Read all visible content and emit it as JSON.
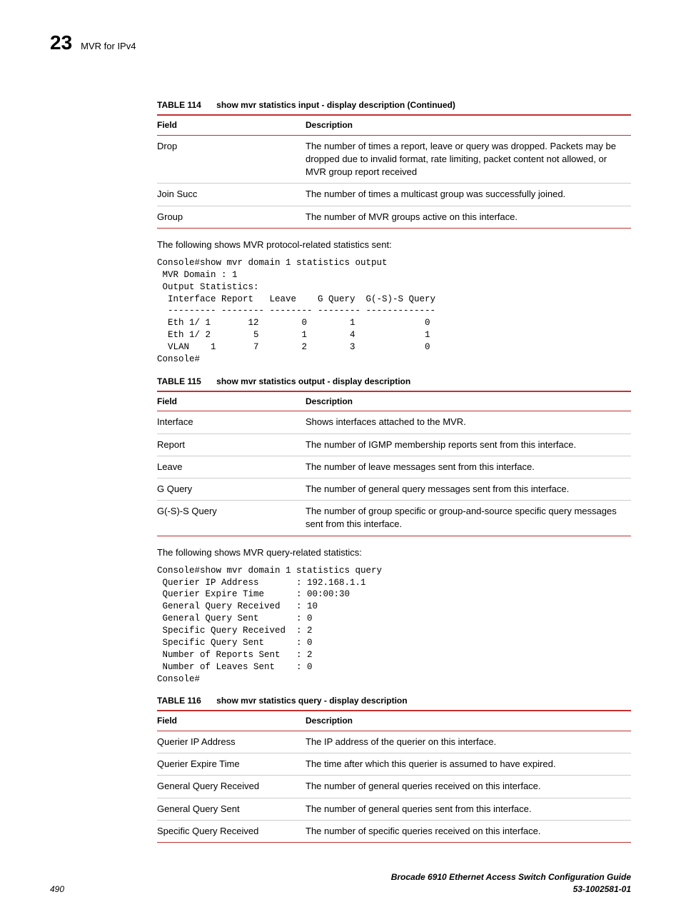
{
  "header": {
    "chapter_num": "23",
    "chapter_title": "MVR for IPv4"
  },
  "table114": {
    "label": "TABLE 114",
    "title": "show mvr statistics input - display description (Continued)",
    "head_field": "Field",
    "head_desc": "Description",
    "rows": [
      {
        "field": "Drop",
        "desc": "The number of times a report, leave or query was dropped. Packets may be dropped due to invalid format, rate limiting, packet content not allowed, or MVR group report received"
      },
      {
        "field": "Join Succ",
        "desc": "The number of times a multicast group was successfully joined."
      },
      {
        "field": "Group",
        "desc": "The number of MVR groups active on this interface."
      }
    ]
  },
  "para1": "The following shows MVR protocol-related statistics sent:",
  "pre1": "Console#show mvr domain 1 statistics output\n MVR Domain : 1\n Output Statistics:\n  Interface Report   Leave    G Query  G(-S)-S Query\n  --------- -------- -------- -------- -------------\n  Eth 1/ 1       12        0        1             0\n  Eth 1/ 2        5        1        4             1\n  VLAN    1       7        2        3             0\nConsole#",
  "table115": {
    "label": "TABLE 115",
    "title": "show mvr statistics output - display description",
    "head_field": "Field",
    "head_desc": "Description",
    "rows": [
      {
        "field": "Interface",
        "desc": "Shows interfaces attached to the MVR."
      },
      {
        "field": "Report",
        "desc": "The number of IGMP membership reports sent from this interface."
      },
      {
        "field": "Leave",
        "desc": "The number of leave messages sent from this interface."
      },
      {
        "field": "G Query",
        "desc": "The number of general query messages sent from this interface."
      },
      {
        "field": "G(-S)-S Query",
        "desc": "The number of group specific or group-and-source specific query messages sent from this interface."
      }
    ]
  },
  "para2": "The following shows MVR query-related statistics:",
  "pre2": "Console#show mvr domain 1 statistics query\n Querier IP Address       : 192.168.1.1\n Querier Expire Time      : 00:00:30\n General Query Received   : 10\n General Query Sent       : 0\n Specific Query Received  : 2\n Specific Query Sent      : 0\n Number of Reports Sent   : 2\n Number of Leaves Sent    : 0\nConsole#",
  "table116": {
    "label": "TABLE 116",
    "title": "show mvr statistics query - display description",
    "head_field": "Field",
    "head_desc": "Description",
    "rows": [
      {
        "field": "Querier IP Address",
        "desc": "The IP address of the querier on this interface."
      },
      {
        "field": "Querier Expire Time",
        "desc": "The time after which this querier is assumed to have expired."
      },
      {
        "field": "General Query Received",
        "desc": "The number of general queries received on this interface."
      },
      {
        "field": "General Query Sent",
        "desc": "The number of general queries sent from this interface."
      },
      {
        "field": "Specific Query Received",
        "desc": "The number of specific queries received on this interface."
      }
    ]
  },
  "footer": {
    "page": "490",
    "book": "Brocade 6910 Ethernet Access Switch Configuration Guide",
    "doc": "53-1002581-01"
  }
}
